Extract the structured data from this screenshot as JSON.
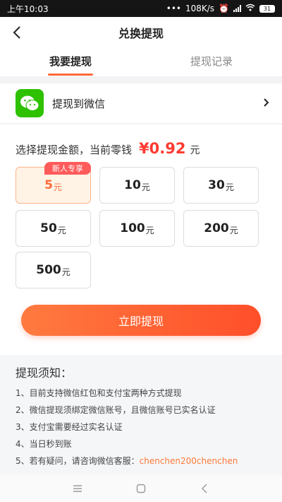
{
  "status_bar": {
    "time": "上午10:03",
    "dots": "•••",
    "speed": "108K/s",
    "battery": "31"
  },
  "nav": {
    "title": "兑换提现"
  },
  "tabs": [
    {
      "label": "我要提现"
    },
    {
      "label": "提现记录"
    }
  ],
  "method": {
    "label": "提现到微信"
  },
  "amount": {
    "prompt": "选择提现金额，当前零钱",
    "value": "¥0.92",
    "unit": "元"
  },
  "options": [
    {
      "num": "5",
      "unit": "元",
      "badge": "新人专享"
    },
    {
      "num": "10",
      "unit": "元"
    },
    {
      "num": "30",
      "unit": "元"
    },
    {
      "num": "50",
      "unit": "元"
    },
    {
      "num": "100",
      "unit": "元"
    },
    {
      "num": "200",
      "unit": "元"
    },
    {
      "num": "500",
      "unit": "元"
    }
  ],
  "submit_label": "立即提现",
  "notice": {
    "title": "提现须知：",
    "items": [
      "1、目前支持微信红包和支付宝两种方式提现",
      "2、微信提现须绑定微信账号，且微信账号已实名认证",
      "3、支付宝需要经过实名认证",
      "4、当日秒到账"
    ],
    "item5_prefix": "5、若有疑问，请咨询微信客服：",
    "item5_contact": "chenchen200chenchen"
  },
  "colors": {
    "accent": "#ff6a3a",
    "price_red": "#ff3b30",
    "wechat_green": "#2dc100"
  }
}
